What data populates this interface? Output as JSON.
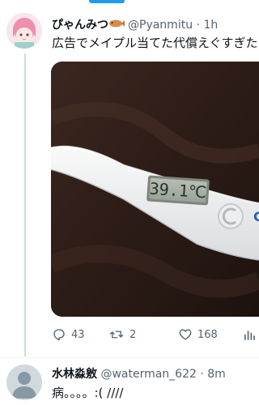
{
  "tweet": {
    "author_name": "ぴゃんみつ",
    "handle": "@Pyanmitu",
    "separator": "·",
    "time": "1h",
    "text": "広告でメイプル当てた代償えぐすぎた",
    "media": {
      "display_text": "39.1℃",
      "brand_fragment": "C"
    },
    "actions": {
      "replies": "43",
      "retweets": "2",
      "likes": "168"
    }
  },
  "reply": {
    "author_name": "水林淼敫",
    "handle": "@waterman_622",
    "separator": "·",
    "time": "8m",
    "text": "病。。。。:(  ////"
  },
  "colors": {
    "accent": "#1d9bf0",
    "secondary_text": "#536471",
    "line": "#cfd9de"
  }
}
